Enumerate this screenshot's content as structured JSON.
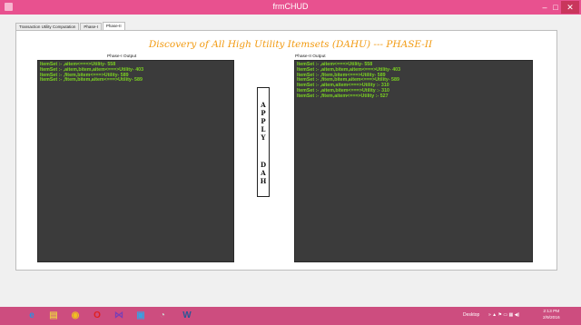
{
  "window": {
    "title": "frmCHUD",
    "minimize_icon": "minimize-icon",
    "maximize_icon": "maximize-icon",
    "close_icon": "close-icon",
    "minimize_glyph": "–",
    "maximize_glyph": "□",
    "close_glyph": "✕",
    "accent_color": "#e8518f"
  },
  "tabs": [
    {
      "label": "Transaction Utility Computation",
      "active": false
    },
    {
      "label": "Phase-I",
      "active": false
    },
    {
      "label": "Phase-II",
      "active": true
    }
  ],
  "main": {
    "heading": "Discovery of All High Utility Itemsets (DAHU) --- PHASE-II",
    "phase1": {
      "label": "Phase-I Output",
      "lines": [
        "ItemSet :- ,aitem<===>Utility- 558",
        "ItemSet :- ,aitem,bitem,aitem<===>Utility- 403",
        "ItemSet :- ,fitem,bitem<===>Utility- 589",
        "ItemSet :- ,fitem,bitem,aitem<===>Utility- 589"
      ]
    },
    "phase2": {
      "label": "Phase-II Output",
      "lines": [
        "ItemSet :- ,aitem<===>Utility- 558",
        "ItemSet :- ,aitem,bitem,aitem<===>Utility- 403",
        "ItemSet :- ,fitem,bitem<===>Utility- 589",
        "ItemSet :- ,fitem,bitem,aitem<===>Utility- 589",
        "ItemSet :- ,aitem,aitem<===>Utility :- 310",
        "ItemSet :- ,aitem,bitem<===>Utility :- 310",
        "ItemSet :- ,fitem,aitem<===>Utility :- 527"
      ]
    },
    "apply_button": {
      "letters_top": [
        "A",
        "P",
        "P",
        "L",
        "Y"
      ],
      "letters_bottom": [
        "D",
        "A",
        "H"
      ]
    }
  },
  "taskbar": {
    "apps": [
      {
        "icon": "internet-explorer-icon",
        "glyph": "e",
        "color": "#2a8fe0"
      },
      {
        "icon": "file-explorer-icon",
        "glyph": "▤",
        "color": "#e8c04a"
      },
      {
        "icon": "chrome-icon",
        "glyph": "◉",
        "color": "#f0c020"
      },
      {
        "icon": "opera-icon",
        "glyph": "O",
        "color": "#e02020"
      },
      {
        "icon": "visual-studio-icon",
        "glyph": "⋈",
        "color": "#7a3fb5"
      },
      {
        "icon": "windows-media-icon",
        "glyph": "▣",
        "color": "#3aa0e0"
      },
      {
        "icon": "paint-icon",
        "glyph": "◔",
        "color": "#cfcfcf"
      },
      {
        "icon": "word-icon",
        "glyph": "W",
        "color": "#2b5797"
      }
    ],
    "desktop_label": "Desktop",
    "tray_glyphs": "» ▲ ⚑ ▭ ▦ ◀)",
    "time": "2:13 PM",
    "date": "2/9/2016"
  }
}
